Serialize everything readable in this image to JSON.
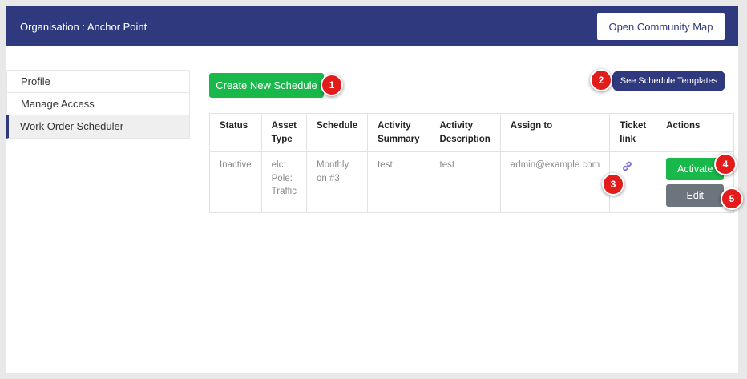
{
  "header": {
    "org_label": "Organisation : Anchor Point",
    "map_button": "Open Community Map"
  },
  "sidebar": {
    "items": [
      {
        "label": "Profile"
      },
      {
        "label": "Manage Access"
      },
      {
        "label": "Work Order Scheduler",
        "active": true
      }
    ]
  },
  "toolbar": {
    "create_button": "Create New Schedule",
    "templates_button": "See Schedule Templates"
  },
  "table": {
    "headers": {
      "status": "Status",
      "asset_type_1": "Asset",
      "asset_type_2": "Type",
      "schedule": "Schedule",
      "summary_1": "Activity",
      "summary_2": "Summary",
      "description_1": "Activity",
      "description_2": "Description",
      "assign": "Assign to",
      "ticket_1": "Ticket",
      "ticket_2": "link",
      "actions": "Actions"
    },
    "rows": [
      {
        "status": "Inactive",
        "asset_type_1": "elc:",
        "asset_type_2": "Pole:",
        "asset_type_3": "Traffic",
        "schedule_1": "Monthly",
        "schedule_2": "on #3",
        "summary": "test",
        "description": "test",
        "assign": "admin@example.com",
        "ticket_icon": "link-icon",
        "activate_button": "Activate",
        "edit_button": "Edit"
      }
    ]
  },
  "callouts": [
    "1",
    "2",
    "3",
    "4",
    "5"
  ],
  "colors": {
    "brand": "#2f3a7e",
    "success": "#19b84a",
    "secondary": "#6c757d",
    "callout": "#e21b1b",
    "link_icon": "#7b6fd6"
  }
}
